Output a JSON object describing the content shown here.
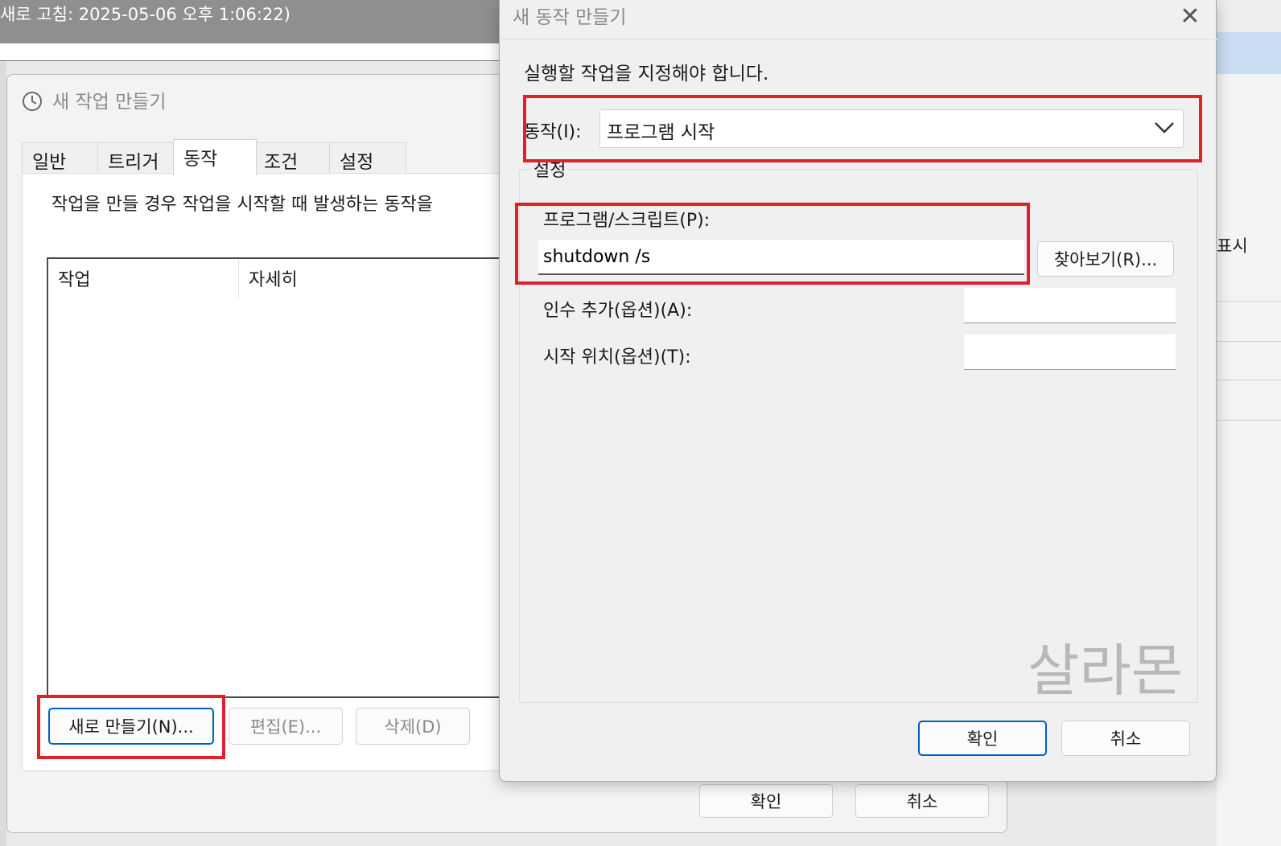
{
  "background_window": {
    "title": "새로 고침: 2025-05-06 오후 1:06:22)",
    "right_text": "표시"
  },
  "task_dialog": {
    "title": "새 작업 만들기",
    "tabs": [
      {
        "label": "일반"
      },
      {
        "label": "트리거"
      },
      {
        "label": "동작"
      },
      {
        "label": "조건"
      },
      {
        "label": "설정"
      }
    ],
    "active_tab": "동작",
    "description": "작업을 만들 경우 작업을 시작할 때 발생하는 동작을",
    "columns": [
      "작업",
      "자세히"
    ],
    "buttons": {
      "new": "새로 만들기(N)...",
      "edit": "편집(E)...",
      "delete": "삭제(D)"
    },
    "footer_buttons": {
      "ok": "확인",
      "cancel": "취소"
    }
  },
  "action_dialog": {
    "title": "새 동작 만들기",
    "close": "✕",
    "instruction": "실행할 작업을 지정해야 합니다.",
    "action_label": "동작(I):",
    "action_value": "프로그램 시작",
    "settings_title": "설정",
    "program_label": "프로그램/스크립트(P):",
    "program_value": "shutdown /s",
    "browse_label": "찾아보기(R)...",
    "args_label": "인수 추가(옵션)(A):",
    "args_value": "",
    "startin_label": "시작 위치(옵션)(T):",
    "startin_value": "",
    "watermark": "살라몬",
    "ok_label": "확인",
    "cancel_label": "취소"
  },
  "colors": {
    "highlight": "#e0202c",
    "primary_border": "#0060c0",
    "dialog_bg": "#f0f0f0"
  }
}
